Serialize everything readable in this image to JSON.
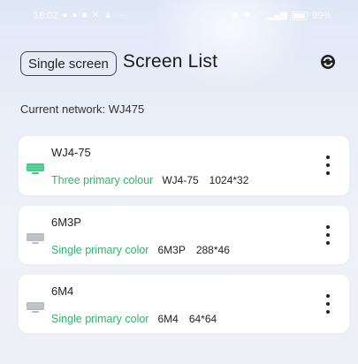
{
  "status_bar": {
    "time": "16:02",
    "battery": "99%"
  },
  "header": {
    "mode_button_label": "Single screen",
    "title": "Screen List",
    "refresh_icon": "refresh-icon"
  },
  "network": {
    "label": "Current network:",
    "name": "WJ475"
  },
  "screens": [
    {
      "name": "WJ4-75",
      "color_type": "Three primary colour",
      "model": "WJ4-75",
      "resolution": "1024*32",
      "icon": "led-screen-icon",
      "icon_color": "#3ccf83"
    },
    {
      "name": "6M3P",
      "color_type": "Single primary color",
      "model": "6M3P",
      "resolution": "288*46",
      "icon": "led-screen-icon",
      "icon_color": "#b8bcc2"
    },
    {
      "name": "6M4",
      "color_type": "Single primary color",
      "model": "6M4",
      "resolution": "64*64",
      "icon": "led-screen-icon",
      "icon_color": "#b8bcc2"
    }
  ],
  "colors": {
    "accent_green": "#2cb66b",
    "card_bg": "#ffffff",
    "page_bg": "#eef0f5"
  }
}
